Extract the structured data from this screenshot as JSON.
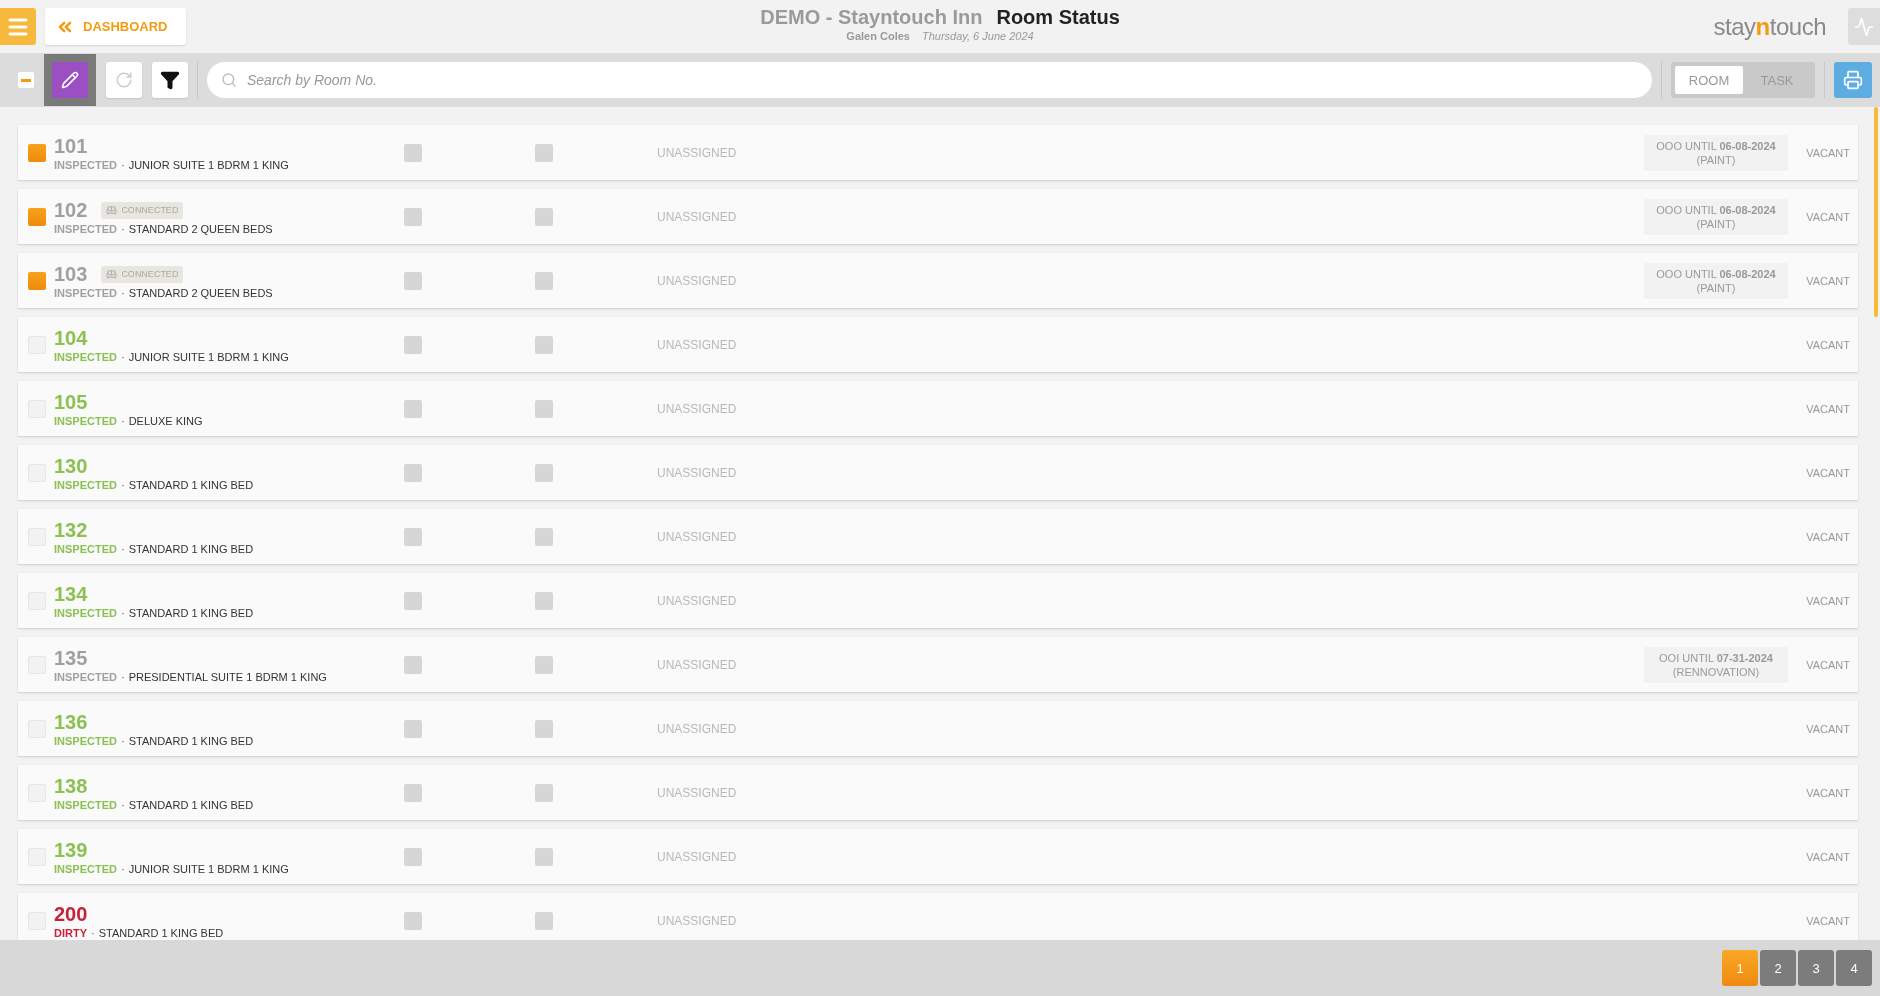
{
  "header": {
    "back_label": "DASHBOARD",
    "hotel": "DEMO - Stayntouch Inn",
    "title": "Room Status",
    "user": "Galen Coles",
    "date": "Thursday, 6 June 2024",
    "logo": {
      "before": "stay",
      "accent": "n",
      "after": "touch"
    }
  },
  "toolbar": {
    "select_all": {
      "checked": true
    },
    "edit_mode": {
      "selected": true
    },
    "search": {
      "placeholder": "Search by Room No."
    },
    "view_tabs": [
      {
        "label": "ROOM",
        "selected": true
      },
      {
        "label": "TASK",
        "selected": false
      }
    ]
  },
  "rooms": [
    {
      "number": "101",
      "separator": "·",
      "status": "INSPECTED",
      "color": "#a0a0a0",
      "type": "JUNIOR SUITE 1 BDRM 1 KING",
      "checked": true,
      "assignee": "UNASSIGNED",
      "service": {
        "line1": "OOO UNTIL **06-08-2024**",
        "line2": "(PAINT)"
      },
      "occupancy": "VACANT"
    },
    {
      "number": "102",
      "badge": "CONNECTED",
      "separator": "·",
      "status": "INSPECTED",
      "color": "#a0a0a0",
      "type": "STANDARD 2 QUEEN BEDS",
      "checked": true,
      "assignee": "UNASSIGNED",
      "service": {
        "line1": "OOO UNTIL **06-08-2024**",
        "line2": "(PAINT)"
      },
      "occupancy": "VACANT"
    },
    {
      "number": "103",
      "badge": "CONNECTED",
      "separator": "·",
      "status": "INSPECTED",
      "color": "#a0a0a0",
      "type": "STANDARD 2 QUEEN BEDS",
      "checked": true,
      "assignee": "UNASSIGNED",
      "service": {
        "line1": "OOO UNTIL **06-08-2024**",
        "line2": "(PAINT)"
      },
      "occupancy": "VACANT"
    },
    {
      "number": "104",
      "separator": "·",
      "status": "INSPECTED",
      "color": "#8cc152",
      "type": "JUNIOR SUITE 1 BDRM 1 KING",
      "checked": false,
      "assignee": "UNASSIGNED",
      "occupancy": "VACANT"
    },
    {
      "number": "105",
      "separator": "·",
      "status": "INSPECTED",
      "color": "#8cc152",
      "type": "DELUXE KING",
      "checked": false,
      "assignee": "UNASSIGNED",
      "occupancy": "VACANT"
    },
    {
      "number": "130",
      "separator": "·",
      "status": "INSPECTED",
      "color": "#8cc152",
      "type": "STANDARD 1 KING BED",
      "checked": false,
      "assignee": "UNASSIGNED",
      "occupancy": "VACANT"
    },
    {
      "number": "132",
      "separator": "·",
      "status": "INSPECTED",
      "color": "#8cc152",
      "type": "STANDARD 1 KING BED",
      "checked": false,
      "assignee": "UNASSIGNED",
      "occupancy": "VACANT"
    },
    {
      "number": "134",
      "separator": "·",
      "status": "INSPECTED",
      "color": "#8cc152",
      "type": "STANDARD 1 KING BED",
      "checked": false,
      "assignee": "UNASSIGNED",
      "occupancy": "VACANT"
    },
    {
      "number": "135",
      "separator": "·",
      "status": "INSPECTED",
      "color": "#a0a0a0",
      "type": "PRESIDENTIAL SUITE 1 BDRM 1 KING",
      "checked": false,
      "assignee": "UNASSIGNED",
      "service": {
        "line1": "OOI UNTIL **07-31-2024**",
        "line2": "(RENNOVATION)"
      },
      "occupancy": "VACANT"
    },
    {
      "number": "136",
      "separator": "·",
      "status": "INSPECTED",
      "color": "#8cc152",
      "type": "STANDARD 1 KING BED",
      "checked": false,
      "assignee": "UNASSIGNED",
      "occupancy": "VACANT"
    },
    {
      "number": "138",
      "separator": "·",
      "status": "INSPECTED",
      "color": "#8cc152",
      "type": "STANDARD 1 KING BED",
      "checked": false,
      "assignee": "UNASSIGNED",
      "occupancy": "VACANT"
    },
    {
      "number": "139",
      "separator": "·",
      "status": "INSPECTED",
      "color": "#8cc152",
      "type": "JUNIOR SUITE 1 BDRM 1 KING",
      "checked": false,
      "assignee": "UNASSIGNED",
      "occupancy": "VACANT"
    },
    {
      "number": "200",
      "separator": "·",
      "status": "DIRTY",
      "color": "#c8203a",
      "type": "STANDARD 1 KING BED",
      "checked": false,
      "assignee": "UNASSIGNED",
      "occupancy": "VACANT"
    }
  ],
  "pagination": [
    {
      "label": "1",
      "selected": true
    },
    {
      "label": "2",
      "selected": false
    },
    {
      "label": "3",
      "selected": false
    },
    {
      "label": "4",
      "selected": false
    }
  ]
}
